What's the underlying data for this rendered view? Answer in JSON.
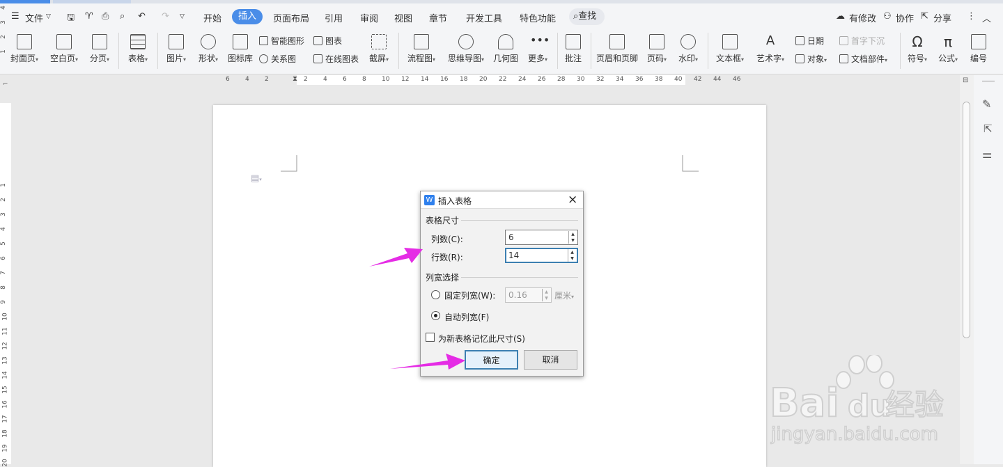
{
  "menubar": {
    "file": "文件",
    "tabs": [
      "开始",
      "插入",
      "页面布局",
      "引用",
      "审阅",
      "视图",
      "章节",
      "开发工具",
      "特色功能"
    ],
    "search": "查找",
    "right": {
      "changes": "有修改",
      "collab": "协作",
      "share": "分享"
    }
  },
  "ribbon": {
    "cover": "封面页",
    "blank": "空白页",
    "pagebreak": "分页",
    "table": "表格",
    "picture": "图片",
    "shape": "形状",
    "iconlib": "图标库",
    "smartart": "智能图形",
    "chart": "图表",
    "relation": "关系图",
    "onlinechart": "在线图表",
    "screenshot": "截屏",
    "flowchart": "流程图",
    "mindmap": "思维导图",
    "geometry": "几何图",
    "more": "更多",
    "comment": "批注",
    "headerfooter": "页眉和页脚",
    "pagenum": "页码",
    "watermark": "水印",
    "textbox": "文本框",
    "arttext": "艺术字",
    "date": "日期",
    "object": "对象",
    "dropcap": "首字下沉",
    "docparts": "文档部件",
    "symbol": "符号",
    "formula": "公式",
    "numbering": "编号"
  },
  "ruler": {
    "h": [
      "6",
      "4",
      "2",
      "2",
      "4",
      "6",
      "8",
      "10",
      "12",
      "14",
      "16",
      "18",
      "20",
      "22",
      "24",
      "26",
      "28",
      "30",
      "32",
      "34",
      "36",
      "38",
      "40",
      "42",
      "44",
      "46"
    ],
    "v_top": [
      "4",
      "3",
      "2",
      "1"
    ],
    "v": [
      "1",
      "2",
      "3",
      "4",
      "5",
      "6",
      "7",
      "8",
      "9",
      "10",
      "11",
      "12",
      "13",
      "14",
      "15",
      "16",
      "17",
      "18",
      "19",
      "20"
    ]
  },
  "dialog": {
    "title": "插入表格",
    "size_group": "表格尺寸",
    "cols_label": "列数(C):",
    "cols_value": "6",
    "rows_label": "行数(R):",
    "rows_value": "14",
    "width_group": "列宽选择",
    "fixed_label": "固定列宽(W):",
    "fixed_value": "0.16",
    "unit": "厘米",
    "auto_label": "自动列宽(F)",
    "remember_label": "为新表格记忆此尺寸(S)",
    "ok": "确定",
    "cancel": "取消"
  },
  "watermark": {
    "brand": "Bai",
    "brand2": "du",
    "cn": "经验",
    "url": "jingyan.baidu.com"
  },
  "colors": {
    "accent": "#4a8de8",
    "arrow": "#e52ce5"
  }
}
